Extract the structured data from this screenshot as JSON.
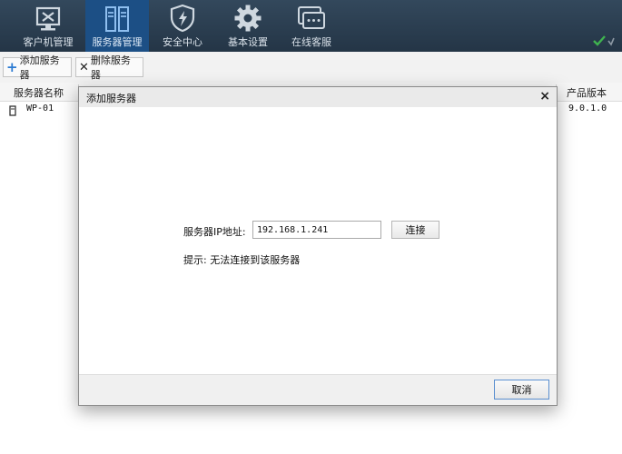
{
  "nav": {
    "items": [
      {
        "label": "客户机管理",
        "icon": "monitor-tools-icon"
      },
      {
        "label": "服务器管理",
        "icon": "server-icon"
      },
      {
        "label": "安全中心",
        "icon": "shield-icon"
      },
      {
        "label": "基本设置",
        "icon": "gear-icon"
      },
      {
        "label": "在线客服",
        "icon": "chat-icon"
      }
    ],
    "active_index": 1
  },
  "toolbar": {
    "add_label": "添加服务器",
    "delete_label": "删除服务器"
  },
  "table": {
    "columns": [
      "服务器名称",
      "产品版本"
    ],
    "rows": [
      {
        "name": "WP-01",
        "version": "9.0.1.0"
      }
    ]
  },
  "dialog": {
    "title": "添加服务器",
    "close_glyph": "×",
    "ip_label": "服务器IP地址:",
    "ip_value": "192.168.1.241",
    "connect_label": "连接",
    "tip": "提示: 无法连接到该服务器",
    "cancel_label": "取消"
  },
  "colors": {
    "nav_bg": "#2b3f52",
    "nav_active": "#1c4f85",
    "check_green": "#3fb34f",
    "plus_blue": "#2a7ad2"
  }
}
